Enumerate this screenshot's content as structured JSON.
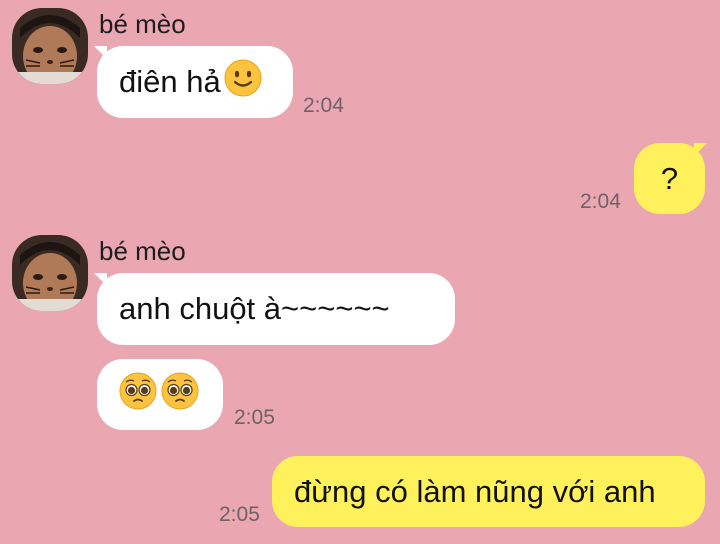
{
  "messages": [
    {
      "sender": "bé mèo",
      "text": "điên hả",
      "emoji": "slightly-smiling-face",
      "time": "2:04"
    },
    {
      "sender": "me",
      "text": "?",
      "time": "2:04"
    },
    {
      "sender": "bé mèo",
      "text": "anh chuột à~~~~~~"
    },
    {
      "sender": "bé mèo",
      "text": "",
      "emoji": "pleading-face pleading-face",
      "time": "2:05"
    },
    {
      "sender": "me",
      "text": "đừng có làm nũng với anh",
      "time": "2:05"
    }
  ],
  "colors": {
    "background": "#eaa7b1",
    "incoming_bubble": "#ffffff",
    "outgoing_bubble": "#fff15b",
    "timestamp": "#6e6266"
  }
}
